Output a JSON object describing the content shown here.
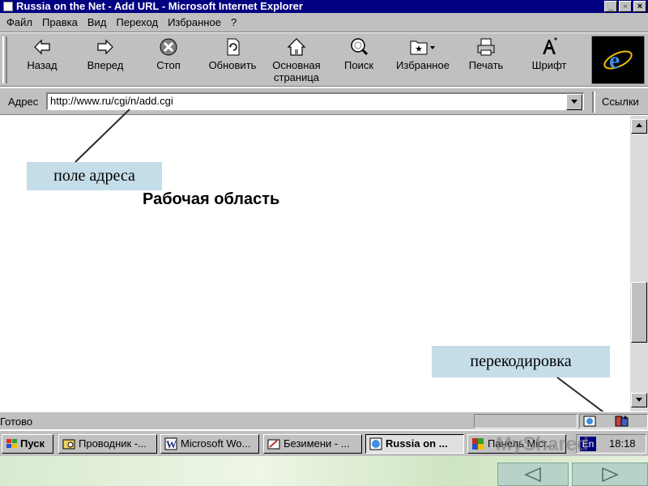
{
  "window": {
    "title": "Russia on the Net - Add URL - Microsoft Internet Explorer",
    "controls": {
      "minimize": "_",
      "maximize": "▫",
      "close": "×"
    }
  },
  "menu": [
    "Файл",
    "Правка",
    "Вид",
    "Переход",
    "Избранное",
    "?"
  ],
  "toolbar": {
    "back": "Назад",
    "forward": "Вперед",
    "stop": "Стоп",
    "refresh": "Обновить",
    "home_line1": "Основная",
    "home_line2": "страница",
    "search": "Поиск",
    "favorites": "Избранное",
    "print": "Печать",
    "font": "Шрифт"
  },
  "address": {
    "label": "Адрес",
    "url": "http://www.ru/cgi/n/add.cgi",
    "links_label": "Ссылки"
  },
  "content": {
    "heading": "Рабочая область"
  },
  "callouts": {
    "address_field": "поле адреса",
    "encoding": "перекодировка"
  },
  "status": {
    "text": "Готово"
  },
  "taskbar": {
    "start": "Пуск",
    "tasks": [
      "Проводник -...",
      "Microsoft Wo...",
      "Безимени - ...",
      "Russia on ...",
      "Панель Micr..."
    ],
    "lang": "En",
    "clock": "18:18"
  },
  "watermark": "MyShared",
  "colors": {
    "titlebar": "#000080",
    "chrome": "#c0c0c0",
    "callout": "#c5dde8"
  }
}
